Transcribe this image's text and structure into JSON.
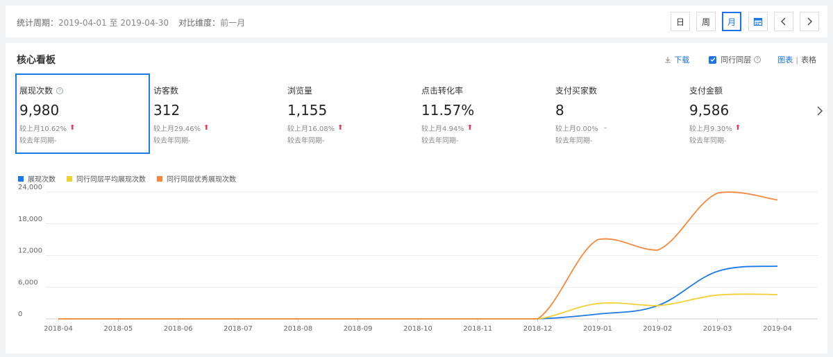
{
  "header": {
    "period_label": "统计周期：",
    "period_value": "2019-04-01 至 2019-04-30",
    "compare_label": "对比维度：",
    "compare_value": "前一月",
    "buttons": {
      "day": "日",
      "week": "周",
      "month": "月"
    }
  },
  "panel": {
    "title": "核心看板",
    "download": "下载",
    "peer_label": "同行同层",
    "view_chart": "图表",
    "view_sep": "|",
    "view_table": "表格"
  },
  "metrics": [
    {
      "label": "展现次数",
      "value": "9,980",
      "mom": "较上月10.62%",
      "trend": "up",
      "yoy": "较去年同期-"
    },
    {
      "label": "访客数",
      "value": "312",
      "mom": "较上月29.46%",
      "trend": "up",
      "yoy": "较去年同期-"
    },
    {
      "label": "浏览量",
      "value": "1,155",
      "mom": "较上月16.08%",
      "trend": "up",
      "yoy": "较去年同期-"
    },
    {
      "label": "点击转化率",
      "value": "11.57%",
      "mom": "较上月4.94%",
      "trend": "up",
      "yoy": "较去年同期-"
    },
    {
      "label": "支付买家数",
      "value": "8",
      "mom": "较上月0.00%",
      "trend": "flat",
      "yoy": "较去年同期-"
    },
    {
      "label": "支付金额",
      "value": "9,586",
      "mom": "较上月9.30%",
      "trend": "up",
      "yoy": "较去年同期-"
    }
  ],
  "trend_symbols": {
    "up": "⬆",
    "flat": "–"
  },
  "colors": {
    "accent": "#1a73e8",
    "series1": "#1a7ae8",
    "series2": "#f5d033",
    "series3": "#f5883a",
    "up": "#e8344e"
  },
  "chart_data": {
    "type": "line",
    "x": [
      "2018-04",
      "2018-05",
      "2018-06",
      "2018-07",
      "2018-08",
      "2018-09",
      "2018-10",
      "2018-11",
      "2018-12",
      "2019-01",
      "2019-02",
      "2019-03",
      "2019-04"
    ],
    "yticks": [
      0,
      6000,
      12000,
      18000,
      24000
    ],
    "ytick_labels": [
      "0",
      "6,000",
      "12,000",
      "18,000",
      "24,000"
    ],
    "ylim": [
      0,
      24000
    ],
    "grid": true,
    "legend_position": "top-left",
    "series": [
      {
        "name": "展现次数",
        "color": "#1a7ae8",
        "values": [
          0,
          0,
          0,
          0,
          0,
          0,
          0,
          0,
          0,
          900,
          2500,
          9000,
          9980
        ]
      },
      {
        "name": "同行同层平均展现次数",
        "color": "#f5d033",
        "values": [
          0,
          0,
          0,
          0,
          0,
          0,
          0,
          0,
          0,
          2900,
          2500,
          4500,
          4600
        ]
      },
      {
        "name": "同行同层优秀展现次数",
        "color": "#f5883a",
        "values": [
          0,
          0,
          0,
          0,
          0,
          0,
          0,
          0,
          0,
          15000,
          13000,
          23800,
          22500
        ]
      }
    ]
  }
}
